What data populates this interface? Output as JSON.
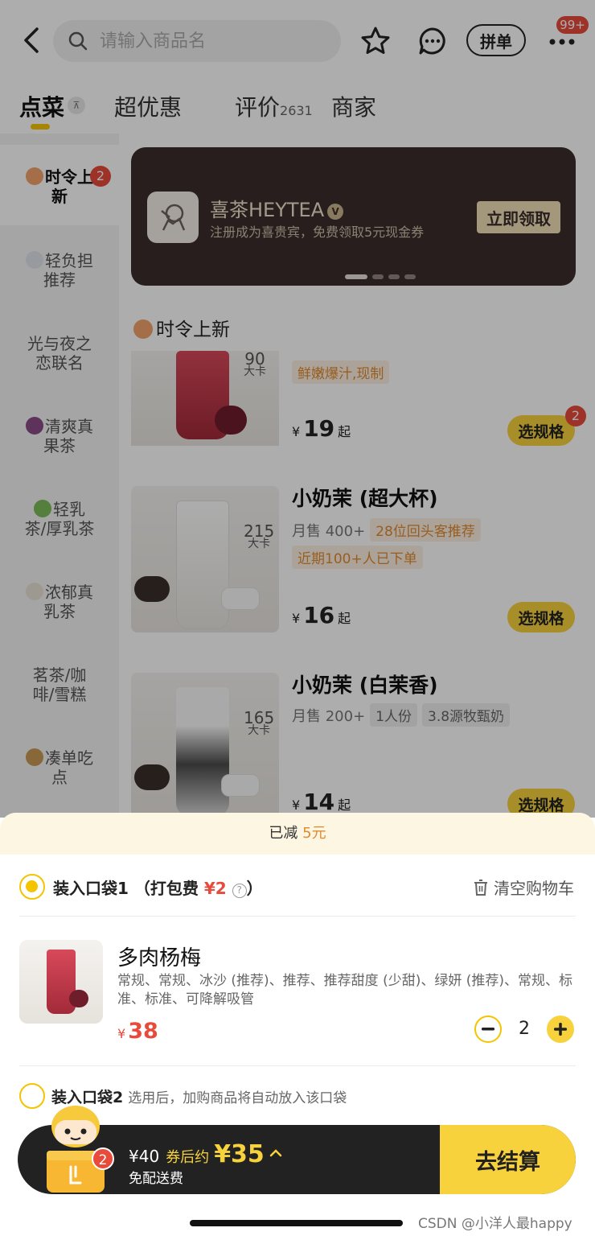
{
  "search": {
    "placeholder": "请输入商品名"
  },
  "header": {
    "pindan": "拼单",
    "more_badge": "99+"
  },
  "tabs": [
    {
      "label": "点菜"
    },
    {
      "label": "超优惠"
    },
    {
      "label": "评价",
      "count": "2631"
    },
    {
      "label": "商家"
    }
  ],
  "sidebar": {
    "items": [
      {
        "label1": "时令上",
        "label2": "新",
        "badge": "2"
      },
      {
        "label1": "轻负担",
        "label2": "推荐"
      },
      {
        "label1": "光与夜之",
        "label2": "恋联名"
      },
      {
        "label1": "清爽真",
        "label2": "果茶"
      },
      {
        "label1": "轻乳",
        "label2": "茶/厚乳茶"
      },
      {
        "label1": "浓郁真",
        "label2": "乳茶"
      },
      {
        "label1": "茗茶/咖",
        "label2": "啡/雪糕"
      },
      {
        "label1": "凑单吃",
        "label2": "点"
      }
    ]
  },
  "banner": {
    "title": "喜茶HEYTEA",
    "verified": "V",
    "subtitle": "注册成为喜贵宾，免费领取5元现金券",
    "button": "立即领取"
  },
  "section": {
    "title": "时令上新"
  },
  "products": [
    {
      "name": "",
      "tags": [
        "鲜嫩爆汁,现制"
      ],
      "currency": "¥",
      "price": "19",
      "suffix": "起",
      "spec": "选规格",
      "spec_badge": "2",
      "kcal": "90",
      "kcal_unit": "大卡"
    },
    {
      "name": "小奶茉 (超大杯)",
      "sales": "月售 400+",
      "tags": [
        "28位回头客推荐",
        "近期100+人已下单"
      ],
      "currency": "¥",
      "price": "16",
      "suffix": "起",
      "spec": "选规格",
      "kcal": "215",
      "kcal_unit": "大卡"
    },
    {
      "name": "小奶茉 (白茉香)",
      "sales": "月售 200+",
      "tags": [
        "1人份",
        "3.8源牧甄奶"
      ],
      "currency": "¥",
      "price": "14",
      "suffix": "起",
      "spec": "选规格",
      "kcal": "165",
      "kcal_unit": "大卡"
    }
  ],
  "cart": {
    "discount_prefix": "已减",
    "discount_amount": "5元",
    "bag1_label": "装入口袋1 （打包费",
    "bag1_fee": "¥2",
    "bag1_close": "）",
    "clear": "清空购物车",
    "item": {
      "name": "多肉杨梅",
      "options": "常规、常规、冰沙 (推荐)、推荐、推荐甜度 (少甜)、绿妍 (推荐)、常规、标准、标准、可降解吸管",
      "currency": "¥",
      "price": "38",
      "qty": "2"
    },
    "bag2_label": "装入口袋2",
    "bag2_hint": "选用后，加购商品将自动放入该口袋"
  },
  "checkout": {
    "original": "¥40",
    "coupon_label": "券后约",
    "final": "¥35",
    "delivery": "免配送费",
    "button": "去结算",
    "badge": "2"
  },
  "watermark": "CSDN @小洋人最happy",
  "colors": {
    "accent": "#f7d23d",
    "price_red": "#e84a3c",
    "banner_bg": "#3a2d2b"
  }
}
